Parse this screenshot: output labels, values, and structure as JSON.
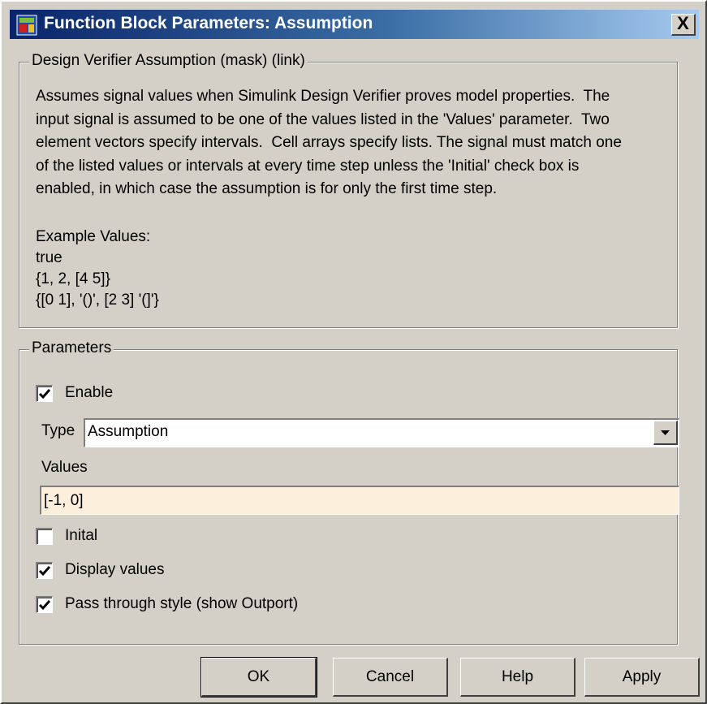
{
  "window": {
    "title": "Function Block Parameters: Assumption",
    "close_label": "X"
  },
  "description": {
    "group_title": "Design Verifier Assumption (mask) (link)",
    "lines": [
      "Assumes signal values when Simulink Design Verifier proves model properties.  The",
      "input signal is assumed to be one of the values listed in the 'Values' parameter.  Two",
      "element vectors specify intervals.  Cell arrays specify lists. The signal must match one",
      "of the listed values or intervals at every time step unless the 'Initial' check box is",
      "enabled, in which case the assumption is for only the first time step."
    ],
    "examples_title": "Example Values:",
    "examples": [
      "true",
      "{1, 2, [4 5]}",
      "{[0 1], '()', [2 3] '(]'}"
    ]
  },
  "parameters": {
    "group_title": "Parameters",
    "enable": {
      "label": "Enable",
      "checked": true
    },
    "type": {
      "label": "Type",
      "value": "Assumption"
    },
    "values": {
      "label": "Values",
      "value": "[-1, 0]"
    },
    "initial": {
      "label": "Inital",
      "checked": false
    },
    "display_values": {
      "label": "Display values",
      "checked": true
    },
    "pass_through": {
      "label": "Pass through style (show Outport)",
      "checked": true
    }
  },
  "buttons": {
    "ok": "OK",
    "cancel": "Cancel",
    "help": "Help",
    "apply": "Apply"
  },
  "colors": {
    "dialog_bg": "#d4d0c8",
    "title_gradient_start": "#0a246a",
    "title_gradient_end": "#a6caf0",
    "editable_field_bg": "#fcf0dc"
  },
  "icons": {
    "app": "simulink-block-icon",
    "close": "close-icon",
    "dropdown": "chevron-down-icon",
    "check": "checkmark-icon"
  }
}
